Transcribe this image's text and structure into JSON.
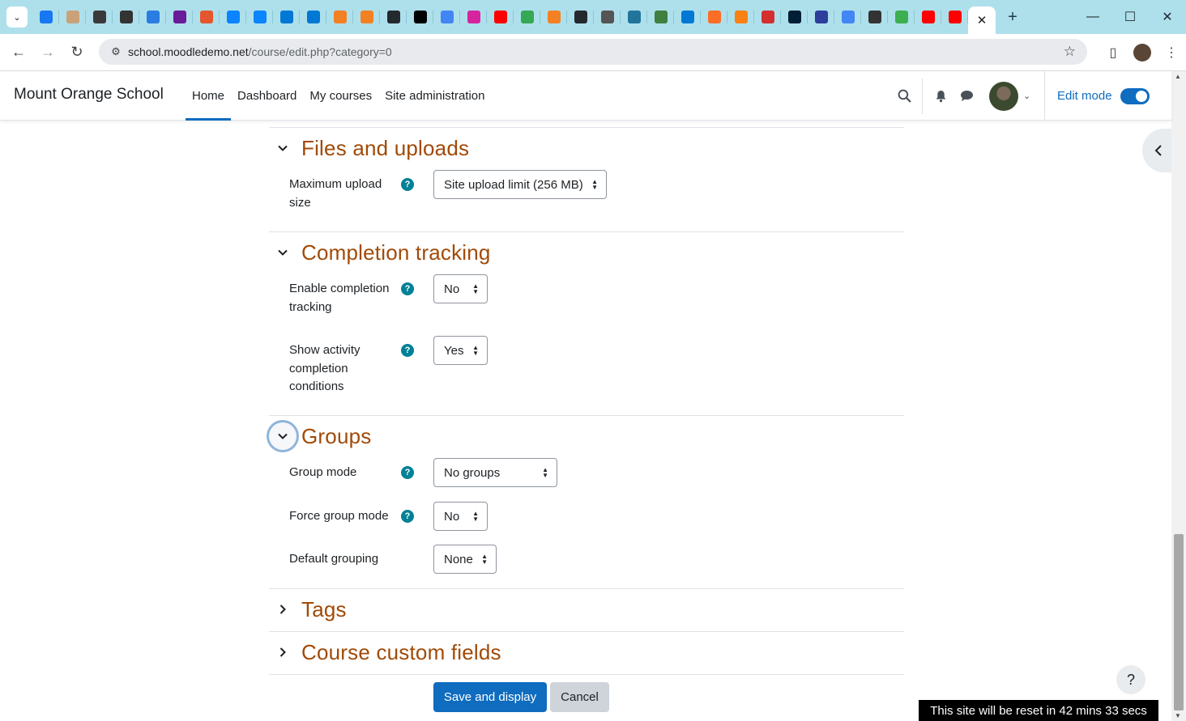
{
  "browser": {
    "tab_favicons": [
      "facebook-icon",
      "avatar-icon",
      "pr-icon",
      "bookmark-icon",
      "arrow-icon",
      "mail-icon",
      "puzzle-icon",
      "edge-icon",
      "edge-icon",
      "ms-icon",
      "ms-icon",
      "stack-icon",
      "stack-icon",
      "github-icon",
      "notion-icon",
      "google-icon",
      "instagram-icon",
      "youtube-icon",
      "maps-icon",
      "stack-icon",
      "github-icon",
      "chatgpt-icon",
      "wordpress-icon",
      "frog-icon",
      "ms-icon",
      "gitlab-icon",
      "moodle-icon",
      "c-icon",
      "photoshop-icon",
      "star-icon",
      "google-icon",
      "cat-icon",
      "net-icon",
      "youtube-icon",
      "youtube-icon"
    ],
    "tab_colors": [
      "#1877f2",
      "#c9a27a",
      "#3a3a3a",
      "#333333",
      "#2a7de1",
      "#6a1b9a",
      "#e4572e",
      "#0a84ff",
      "#0a84ff",
      "#0078d4",
      "#0078d4",
      "#f48024",
      "#f48024",
      "#24292e",
      "#000000",
      "#4285f4",
      "#d6249f",
      "#ff0000",
      "#34a853",
      "#f48024",
      "#24292e",
      "#555555",
      "#21759b",
      "#3f7f3f",
      "#0078d4",
      "#fc6d26",
      "#f98012",
      "#d32f2f",
      "#001e36",
      "#2d3e9b",
      "#4285f4",
      "#333333",
      "#3caf50",
      "#ff0000",
      "#ff0000"
    ],
    "url_host": "school.moodledemo.net",
    "url_path": "/course/edit.php?category=0"
  },
  "navbar": {
    "brand": "Mount Orange School",
    "links": [
      "Home",
      "Dashboard",
      "My courses",
      "Site administration"
    ],
    "active_link": "Home",
    "edit_mode_label": "Edit mode",
    "edit_mode_on": true
  },
  "sections": {
    "files": {
      "title": "Files and uploads",
      "max_upload_label": "Maximum upload size",
      "max_upload_value": "Site upload limit (256 MB)"
    },
    "completion": {
      "title": "Completion tracking",
      "enable_label": "Enable completion tracking",
      "enable_value": "No",
      "show_label": "Show activity completion conditions",
      "show_value": "Yes"
    },
    "groups": {
      "title": "Groups",
      "group_mode_label": "Group mode",
      "group_mode_value": "No groups",
      "force_label": "Force group mode",
      "force_value": "No",
      "default_grouping_label": "Default grouping",
      "default_grouping_value": "None"
    },
    "tags": {
      "title": "Tags"
    },
    "custom": {
      "title": "Course custom fields"
    }
  },
  "actions": {
    "save": "Save and display",
    "cancel": "Cancel"
  },
  "footer": {
    "help": "?",
    "reset_notice": "This site will be reset in 42 mins 33 secs"
  },
  "colors": {
    "accent": "#0f6cbf",
    "section_title": "#a14a07",
    "help_icon": "#008196"
  }
}
